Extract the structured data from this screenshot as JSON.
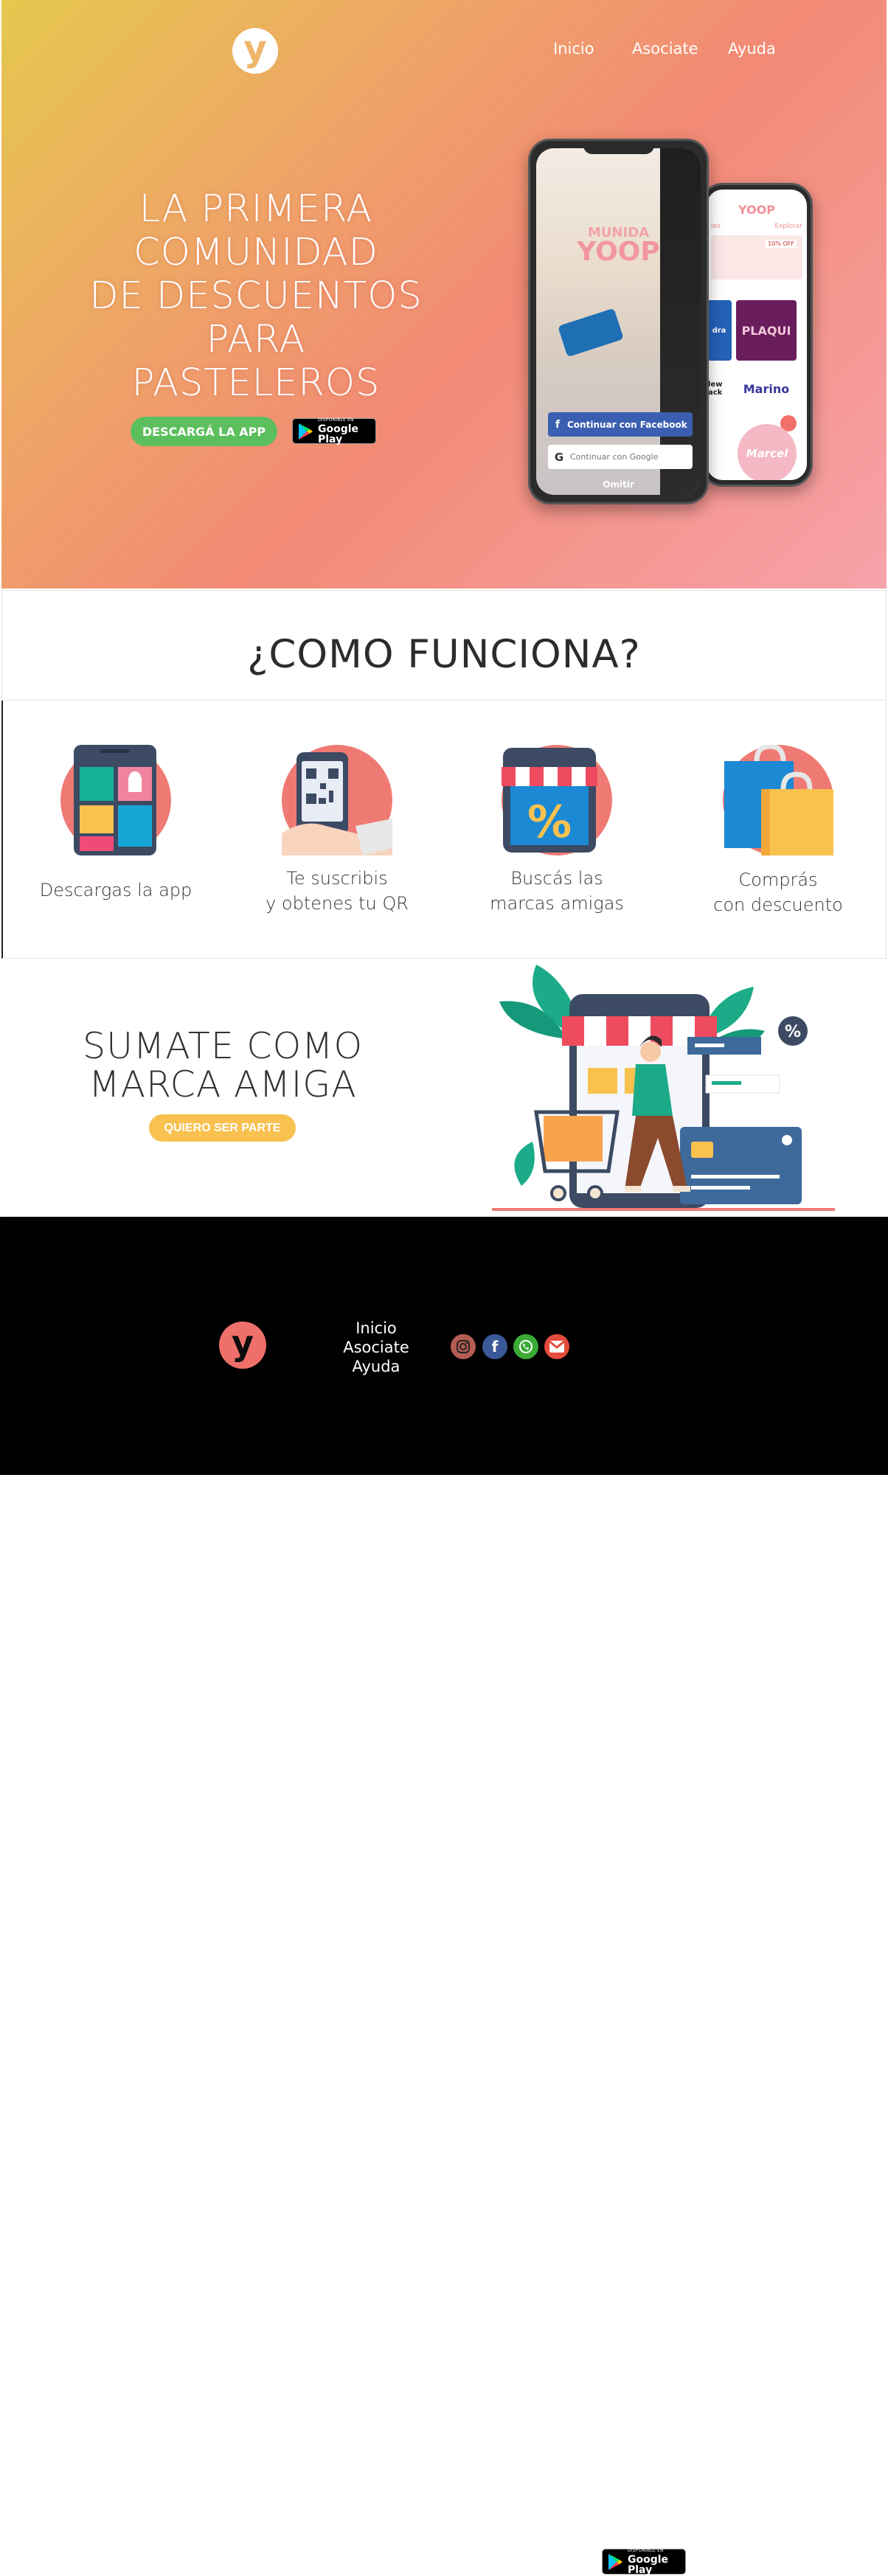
{
  "header": {
    "logo_letter": "y",
    "nav": {
      "inicio": "Inicio",
      "asociate": "Asociate",
      "ayuda": "Ayuda"
    }
  },
  "hero": {
    "headline_lines": [
      "LA PRIMERA",
      "COMUNIDAD",
      "DE DESCUENTOS",
      "PARA",
      "PASTELEROS"
    ],
    "download_button": "DESCARGÁ LA APP",
    "google_play": {
      "small": "DISPONIBLE EN",
      "big": "Google Play"
    },
    "phone_front": {
      "overlay_small": "MUNIDA",
      "overlay_brand": "YOOP",
      "facebook_button": "Continuar con Facebook",
      "google_button": "Continuar con Google",
      "skip": "Omitir"
    },
    "phone_back": {
      "brand": "YOOP",
      "tabs": [
        "les",
        "Explorar"
      ],
      "deal_tag": "10% OFF",
      "tiles": {
        "blue": "dra",
        "plaqui": "PLAQUI",
        "new": "lew ack",
        "marino": "Marino",
        "marcel": "Marcel"
      }
    }
  },
  "how": {
    "title": "¿COMO FUNCIONA?",
    "steps": [
      {
        "line1": "Descargas la app",
        "line2": "",
        "icon": "tablet-apps-icon"
      },
      {
        "line1": "Te suscribis",
        "line2": "y obtenes tu QR",
        "icon": "qr-phone-icon"
      },
      {
        "line1": "Buscás las",
        "line2": "marcas amigas",
        "icon": "store-discount-icon"
      },
      {
        "line1": "Comprás",
        "line2": "con descuento",
        "icon": "shopping-bags-icon"
      }
    ]
  },
  "join": {
    "title_lines": [
      "SUMATE COMO",
      "MARCA AMIGA"
    ],
    "button": "QUIERO SER PARTE"
  },
  "footer": {
    "logo_letter": "y",
    "nav": [
      "Inicio",
      "Asociate",
      "Ayuda"
    ],
    "social_icons": [
      "instagram-icon",
      "facebook-icon",
      "whatsapp-icon",
      "gmail-icon"
    ],
    "google_play": {
      "small": "DISPONIBLE EN",
      "big": "Google Play"
    }
  },
  "colors": {
    "accent_green": "#5cbf5d",
    "accent_yellow": "#f8c150",
    "coral": "#ef7a73",
    "footer_bg": "#000000"
  }
}
